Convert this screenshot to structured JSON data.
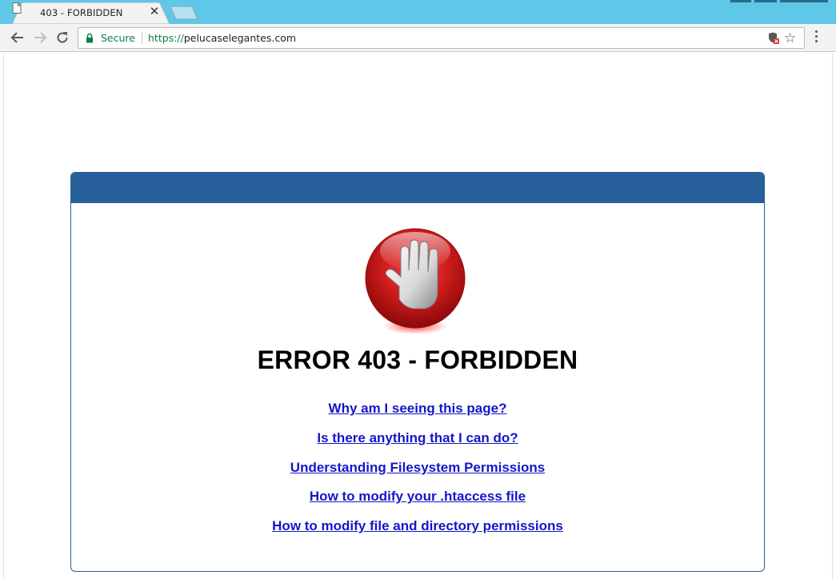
{
  "browser": {
    "tab_title": "403 - FORBIDDEN",
    "close_glyph": "✕",
    "secure_label": "Secure",
    "url_scheme": "https://",
    "url_host": "pelucaselegantes.com",
    "icons": [
      "page-icon",
      "close-icon",
      "new-tab-icon",
      "back-icon",
      "forward-icon",
      "reload-icon",
      "lock-icon",
      "shield-icon",
      "star-icon",
      "menu-icon"
    ]
  },
  "page": {
    "colors": {
      "header": "#27609b",
      "border": "#2b5f8f",
      "link": "#1515c9",
      "hand_red": "#d01c1c"
    },
    "title": "ERROR 403 - FORBIDDEN",
    "links": [
      "Why am I seeing this page?",
      "Is there anything that I can do?",
      "Understanding Filesystem Permissions",
      "How to modify your .htaccess file",
      "How to modify file and directory permissions"
    ]
  }
}
